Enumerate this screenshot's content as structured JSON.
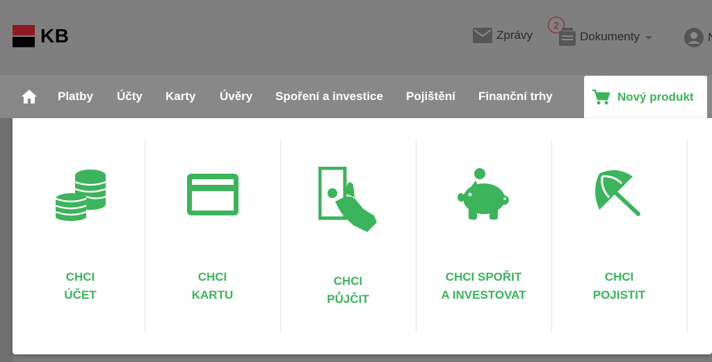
{
  "header": {
    "logo_text": "KB",
    "messages_label": "Zprávy",
    "documents_label": "Dokumenty",
    "documents_badge": "2",
    "user_initial": "N"
  },
  "nav": {
    "items": [
      "Platby",
      "Účty",
      "Karty",
      "Úvěry",
      "Spoření a investice",
      "Pojištění",
      "Finanční trhy"
    ],
    "new_product_label": "Nový produkt"
  },
  "panel": {
    "tiles": [
      {
        "line1": "CHCI",
        "line2": "ÚČET",
        "icon": "coins-icon"
      },
      {
        "line1": "CHCI",
        "line2": "KARTU",
        "icon": "card-icon"
      },
      {
        "line1": "CHCI",
        "line2": "PŮJČIT",
        "icon": "loan-hand-icon"
      },
      {
        "line1": "CHCI SPOŘIT",
        "line2": "A INVESTOVAT",
        "icon": "piggy-bank-icon"
      },
      {
        "line1": "CHCI",
        "line2": "POJISTIT",
        "icon": "umbrella-icon"
      }
    ]
  },
  "colors": {
    "accent_green": "#3cb45b",
    "brand_red": "#8f1a24",
    "overlay_gray": "#7f7f7f"
  }
}
